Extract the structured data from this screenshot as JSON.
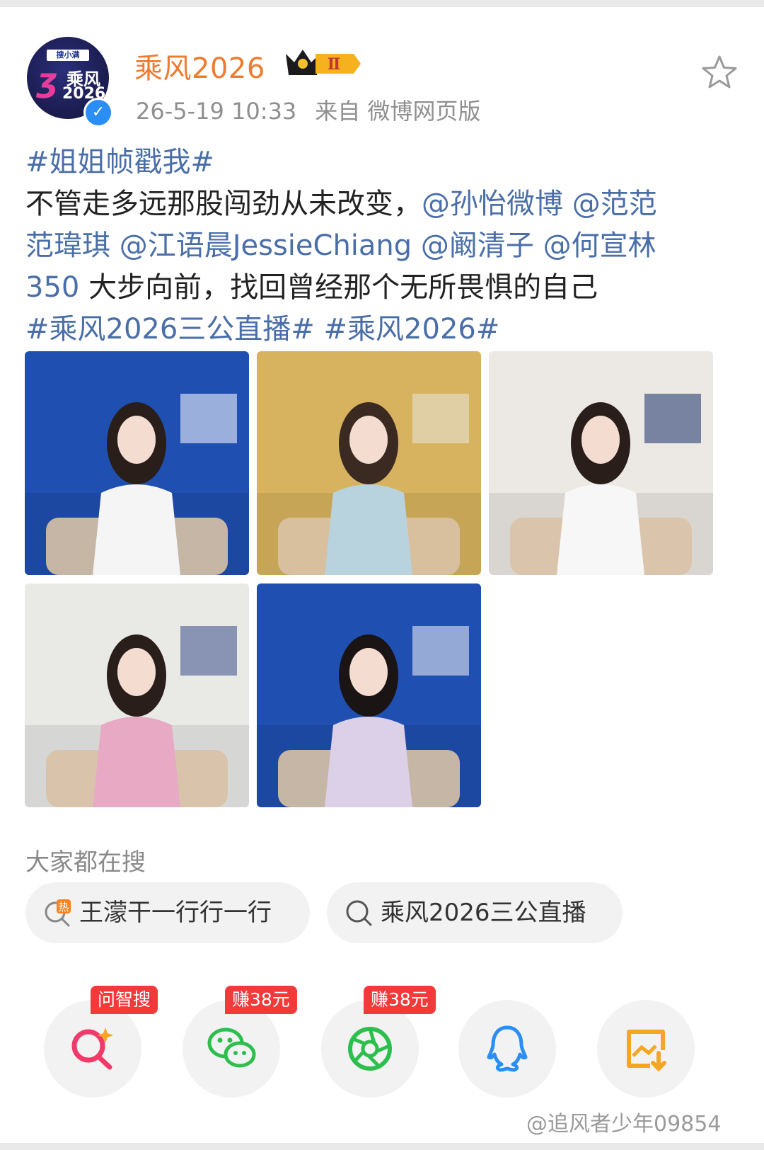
{
  "post": {
    "username": "乘风2026",
    "level_badge": "Ⅱ",
    "timestamp": "26-5-19 10:33",
    "source": "来自 微博网页版",
    "lines": [
      [
        {
          "t": "#姐姐帧戳我#",
          "link": true
        }
      ],
      [
        {
          "t": "不管走多远那股闯劲从未改变，",
          "link": false
        },
        {
          "t": "@孙怡微博 @范范",
          "link": true
        }
      ],
      [
        {
          "t": "范瑋琪 @江语晨JessieChiang @阚清子 @何宣林",
          "link": true
        }
      ],
      [
        {
          "t": "350",
          "link": true
        },
        {
          "t": " 大步向前，找回曾经那个无所畏惧的自己",
          "link": false
        }
      ],
      [
        {
          "t": "#乘风2026三公直播# #乘风2026#",
          "link": true
        }
      ]
    ]
  },
  "avatar": {
    "brand": "搜小满",
    "line1": "乘风",
    "line2": "2026"
  },
  "photos": [
    {
      "bg": "#1f4fb0",
      "accent": "#ffffff",
      "outfit": "#f5f5f5",
      "hair": "#2a1e1a"
    },
    {
      "bg": "#d8b35f",
      "accent": "#e8e4dc",
      "outfit": "#b9d3de",
      "hair": "#3a2a22"
    },
    {
      "bg": "#ece9e4",
      "accent": "#1a2f6a",
      "outfit": "#f7f7f7",
      "hair": "#2a1e1a"
    },
    {
      "bg": "#e9eae6",
      "accent": "#3a4a8a",
      "outfit": "#e7a9c4",
      "hair": "#2a1e1a"
    },
    {
      "bg": "#1f4fb0",
      "accent": "#f4f4f4",
      "outfit": "#dccfe8",
      "hair": "#1a1414"
    }
  ],
  "search": {
    "title": "大家都在搜",
    "chips": [
      {
        "label": "王濛干一行行一行",
        "icon": "hot-search-icon"
      },
      {
        "label": "乘风2026三公直播",
        "icon": "search-icon"
      }
    ]
  },
  "share": {
    "items": [
      {
        "name": "ai-search",
        "badge": "问智搜",
        "color": "#f23a5a"
      },
      {
        "name": "wechat",
        "badge": "赚38元",
        "color": "#2dbf4d"
      },
      {
        "name": "moments",
        "badge": "赚38元",
        "color": "#2dbf4d"
      },
      {
        "name": "qq",
        "badge": "",
        "color": "#2a8ef5"
      },
      {
        "name": "save-image",
        "badge": "",
        "color": "#f5a623"
      }
    ]
  },
  "watermark": "@追风者少年09854"
}
